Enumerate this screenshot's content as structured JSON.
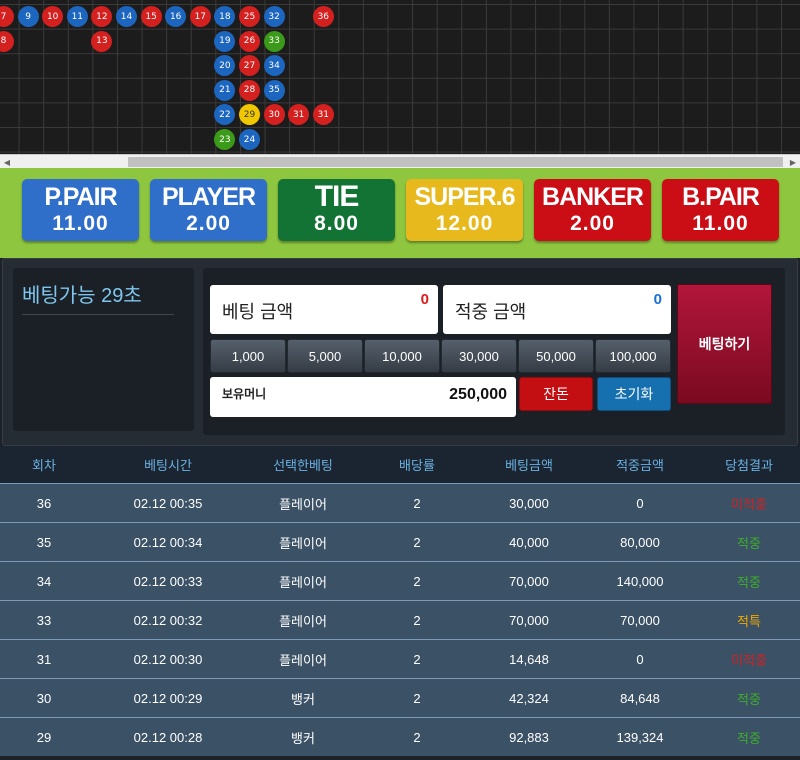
{
  "roadmap": {
    "balls": [
      {
        "n": "7",
        "c": "red",
        "col": 0,
        "row": 0
      },
      {
        "n": "9",
        "c": "blue",
        "col": 1,
        "row": 0
      },
      {
        "n": "10",
        "c": "red",
        "col": 2,
        "row": 0
      },
      {
        "n": "11",
        "c": "blue",
        "col": 3,
        "row": 0
      },
      {
        "n": "12",
        "c": "red",
        "col": 4,
        "row": 0
      },
      {
        "n": "14",
        "c": "blue",
        "col": 5,
        "row": 0
      },
      {
        "n": "15",
        "c": "red",
        "col": 6,
        "row": 0
      },
      {
        "n": "16",
        "c": "blue",
        "col": 7,
        "row": 0
      },
      {
        "n": "17",
        "c": "red",
        "col": 8,
        "row": 0
      },
      {
        "n": "18",
        "c": "blue",
        "col": 9,
        "row": 0
      },
      {
        "n": "25",
        "c": "red",
        "col": 10,
        "row": 0
      },
      {
        "n": "32",
        "c": "blue",
        "col": 11,
        "row": 0
      },
      {
        "n": "36",
        "c": "red",
        "col": 13,
        "row": 0
      },
      {
        "n": "8",
        "c": "red",
        "col": 0,
        "row": 1
      },
      {
        "n": "13",
        "c": "red",
        "col": 4,
        "row": 1
      },
      {
        "n": "19",
        "c": "blue",
        "col": 9,
        "row": 1
      },
      {
        "n": "26",
        "c": "red",
        "col": 10,
        "row": 1
      },
      {
        "n": "33",
        "c": "green",
        "col": 11,
        "row": 1
      },
      {
        "n": "20",
        "c": "blue",
        "col": 9,
        "row": 2
      },
      {
        "n": "27",
        "c": "red",
        "col": 10,
        "row": 2
      },
      {
        "n": "34",
        "c": "blue",
        "col": 11,
        "row": 2
      },
      {
        "n": "21",
        "c": "blue",
        "col": 9,
        "row": 3
      },
      {
        "n": "28",
        "c": "red",
        "col": 10,
        "row": 3
      },
      {
        "n": "35",
        "c": "blue",
        "col": 11,
        "row": 3
      },
      {
        "n": "22",
        "c": "blue",
        "col": 9,
        "row": 4
      },
      {
        "n": "29",
        "c": "yellow",
        "col": 10,
        "row": 4
      },
      {
        "n": "30",
        "c": "red",
        "col": 11,
        "row": 4
      },
      {
        "n": "31",
        "c": "red",
        "col": 12,
        "row": 4
      },
      {
        "n": "31",
        "c": "red",
        "col": 13,
        "row": 4
      },
      {
        "n": "23",
        "c": "green",
        "col": 9,
        "row": 5
      },
      {
        "n": "24",
        "c": "blue",
        "col": 10,
        "row": 5
      }
    ]
  },
  "bets": [
    {
      "name": "P.PAIR",
      "odds": "11.00",
      "color": "#2f6fc9"
    },
    {
      "name": "PLAYER",
      "odds": "2.00",
      "color": "#2f6fc9"
    },
    {
      "name": "TIE",
      "odds": "8.00",
      "color": "#137335"
    },
    {
      "name": "SUPER.6",
      "odds": "12.00",
      "color": "#e8b91c"
    },
    {
      "name": "BANKER",
      "odds": "2.00",
      "color": "#cb0d15"
    },
    {
      "name": "B.PAIR",
      "odds": "11.00",
      "color": "#cb0d15"
    }
  ],
  "panel": {
    "timer": "베팅가능 29초",
    "bet_amount": {
      "label": "베팅 금액",
      "value": "0",
      "color": "#e01a1a"
    },
    "win_amount": {
      "label": "적중 금액",
      "value": "0",
      "color": "#1a6fd6"
    },
    "chips": [
      "1,000",
      "5,000",
      "10,000",
      "30,000",
      "50,000",
      "100,000"
    ],
    "money": {
      "label": "보유머니",
      "value": "250,000"
    },
    "change_label": "잔돈",
    "reset_label": "초기화",
    "submit_label": "베팅하기"
  },
  "history": {
    "headers": [
      "회차",
      "베팅시간",
      "선택한베팅",
      "배당률",
      "베팅금액",
      "적중금액",
      "당첨결과"
    ],
    "rows": [
      {
        "round": "36",
        "time": "02.12 00:35",
        "pick": "플레이어",
        "rate": "2",
        "bet": "30,000",
        "win": "0",
        "result": "미적중",
        "status": "fail"
      },
      {
        "round": "35",
        "time": "02.12 00:34",
        "pick": "플레이어",
        "rate": "2",
        "bet": "40,000",
        "win": "80,000",
        "result": "적중",
        "status": "win"
      },
      {
        "round": "34",
        "time": "02.12 00:33",
        "pick": "플레이어",
        "rate": "2",
        "bet": "70,000",
        "win": "140,000",
        "result": "적중",
        "status": "win"
      },
      {
        "round": "33",
        "time": "02.12 00:32",
        "pick": "플레이어",
        "rate": "2",
        "bet": "70,000",
        "win": "70,000",
        "result": "적특",
        "status": "draw"
      },
      {
        "round": "31",
        "time": "02.12 00:30",
        "pick": "플레이어",
        "rate": "2",
        "bet": "14,648",
        "win": "0",
        "result": "미적중",
        "status": "fail"
      },
      {
        "round": "30",
        "time": "02.12 00:29",
        "pick": "뱅커",
        "rate": "2",
        "bet": "42,324",
        "win": "84,648",
        "result": "적중",
        "status": "win"
      },
      {
        "round": "29",
        "time": "02.12 00:28",
        "pick": "뱅커",
        "rate": "2",
        "bet": "92,883",
        "win": "139,324",
        "result": "적중",
        "status": "win"
      }
    ]
  }
}
